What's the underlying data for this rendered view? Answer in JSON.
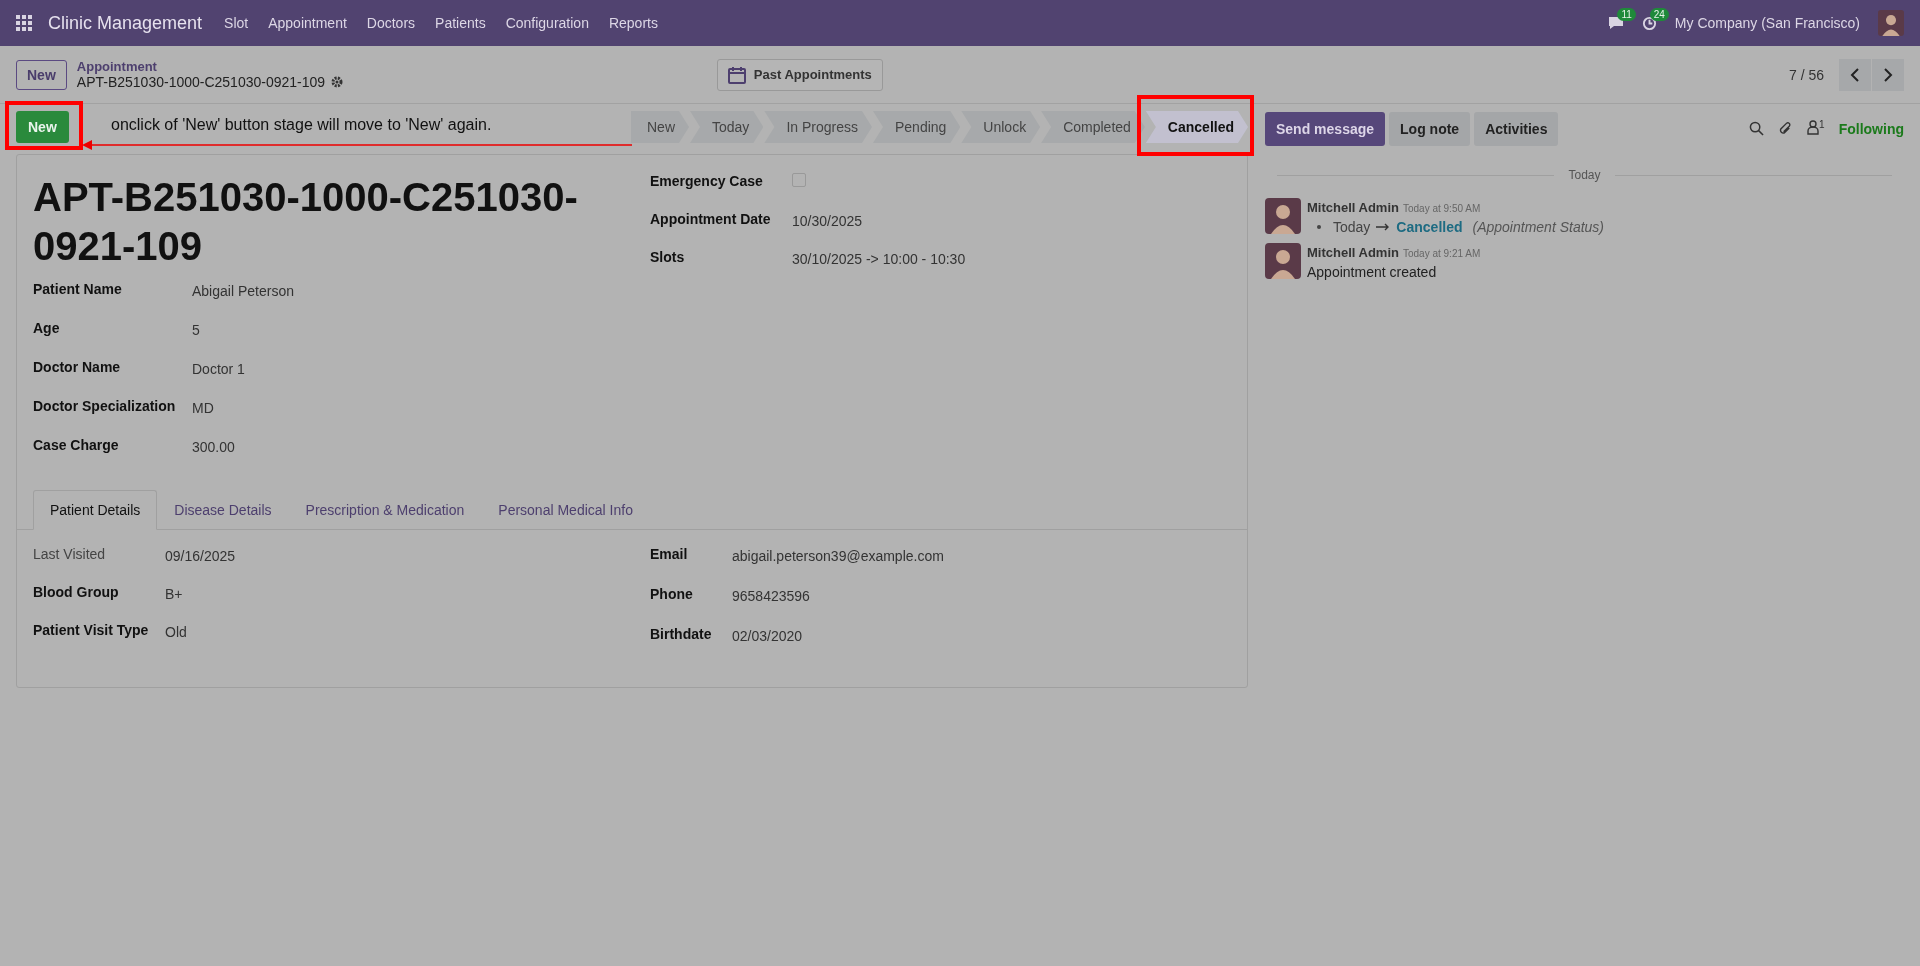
{
  "navbar": {
    "app_name": "Clinic Management",
    "menu": [
      "Slot",
      "Appointment",
      "Doctors",
      "Patients",
      "Configuration",
      "Reports"
    ],
    "messages_count": "11",
    "activities_count": "24",
    "company": "My Company (San Francisco)"
  },
  "control_panel": {
    "new_button": "New",
    "breadcrumb_parent": "Appointment",
    "record_name": "APT-B251030-1000-C251030-0921-109",
    "smart_button": "Past Appointments",
    "pager": "7 / 56"
  },
  "status_bar": {
    "action_button": "New",
    "annotation": "onclick of 'New' button stage will move to 'New' again.",
    "stages": [
      {
        "label": "New",
        "selected": false
      },
      {
        "label": "Today",
        "selected": false
      },
      {
        "label": "In Progress",
        "selected": false
      },
      {
        "label": "Pending",
        "selected": false
      },
      {
        "label": "Unlock",
        "selected": false
      },
      {
        "label": "Completed",
        "selected": false
      },
      {
        "label": "Cancelled",
        "selected": true
      }
    ]
  },
  "form": {
    "title": "APT-B251030-1000-C251030-0921-109",
    "left_fields": [
      {
        "kind": "text",
        "label": "Patient Name",
        "value": "Abigail Peterson"
      },
      {
        "kind": "text",
        "label": "Age",
        "value": "5"
      },
      {
        "kind": "text",
        "label": "Doctor Name",
        "value": "Doctor 1"
      },
      {
        "kind": "text",
        "label": "Doctor Specialization",
        "value": "MD"
      },
      {
        "kind": "text",
        "label": "Case Charge",
        "value": "300.00"
      }
    ],
    "right_fields": [
      {
        "kind": "checkbox",
        "label": "Emergency Case",
        "checked": false
      },
      {
        "kind": "text",
        "label": "Appointment Date",
        "value": "10/30/2025"
      },
      {
        "kind": "text",
        "label": "Slots",
        "value": "30/10/2025 -> 10:00 - 10:30"
      }
    ],
    "tabs": [
      {
        "label": "Patient Details",
        "selected": true
      },
      {
        "label": "Disease Details",
        "selected": false
      },
      {
        "label": "Prescription & Medication",
        "selected": false
      },
      {
        "label": "Personal Medical Info",
        "selected": false
      }
    ],
    "tab_left_fields": [
      {
        "kind": "text",
        "label": "Last Visited",
        "value": "09/16/2025",
        "muted": true
      },
      {
        "kind": "text",
        "label": "Blood Group",
        "value": "B+",
        "muted": false
      },
      {
        "kind": "text",
        "label": "Patient Visit Type",
        "value": "Old",
        "muted": false
      }
    ],
    "tab_right_fields": [
      {
        "kind": "text",
        "label": "Email",
        "value": "abigail.peterson39@example.com",
        "muted": false
      },
      {
        "kind": "text",
        "label": "Phone",
        "value": "9658423596",
        "muted": false
      },
      {
        "kind": "text",
        "label": "Birthdate",
        "value": "02/03/2020",
        "muted": false
      }
    ]
  },
  "chatter": {
    "buttons": [
      {
        "label": "Send message",
        "primary": true
      },
      {
        "label": "Log note",
        "primary": false
      },
      {
        "label": "Activities",
        "primary": false
      }
    ],
    "followers_count": "1",
    "following": "Following",
    "date_separator": "Today",
    "messages": [
      {
        "kind": "tracking",
        "author": "Mitchell Admin",
        "time": "Today at 9:50 AM",
        "old_value": "Today",
        "new_value": "Cancelled",
        "field": "(Appointment Status)"
      },
      {
        "kind": "text",
        "author": "Mitchell Admin",
        "time": "Today at 9:21 AM",
        "body": "Appointment created"
      }
    ]
  }
}
